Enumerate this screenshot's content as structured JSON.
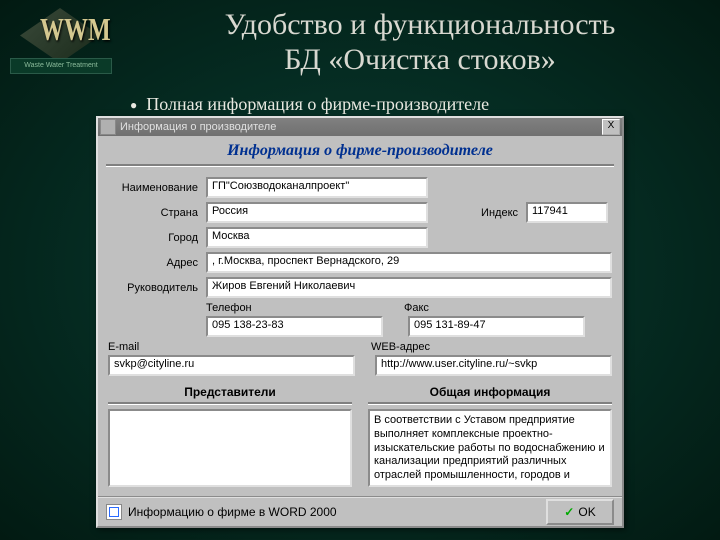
{
  "logo": {
    "main": "WWM",
    "bar": "Waste Water Treatment"
  },
  "title_line1": "Удобство и функциональность",
  "title_line2": "БД «Очистка стоков»",
  "bullet": "Полная информация о фирме-производителе",
  "window": {
    "title": "Информация о производителе",
    "close": "X",
    "header": "Информация о фирме-производителе",
    "labels": {
      "name": "Наименование",
      "country": "Страна",
      "index": "Индекс",
      "city": "Город",
      "address": "Адрес",
      "head": "Руководитель",
      "phone": "Телефон",
      "fax": "Факс",
      "email": "E-mail",
      "web": "WEB-адрес",
      "reps": "Представители",
      "info": "Общая информация"
    },
    "fields": {
      "name": "ГП\"Союзводоканалпроект\"",
      "country": "Россия",
      "index": "117941",
      "city": "Москва",
      "address": ", г.Москва, проспект Вернадского, 29",
      "head": "Жиров Евгений Николаевич",
      "phone": "095 138-23-83",
      "fax": "095 131-89-47",
      "email": "svkp@cityline.ru",
      "web": "http://www.user.cityline.ru/~svkp",
      "reps": "",
      "info": "В соответствии с Уставом предприятие выполняет комплексные проектно-изыскательские работы по водоснабжению и канализации предприятий различных отраслей промышленности, городов и населенных пунктов, включая проектирование гидротехнических"
    },
    "footer": {
      "word": "Информацию о фирме в WORD 2000",
      "ok": "OK"
    }
  }
}
